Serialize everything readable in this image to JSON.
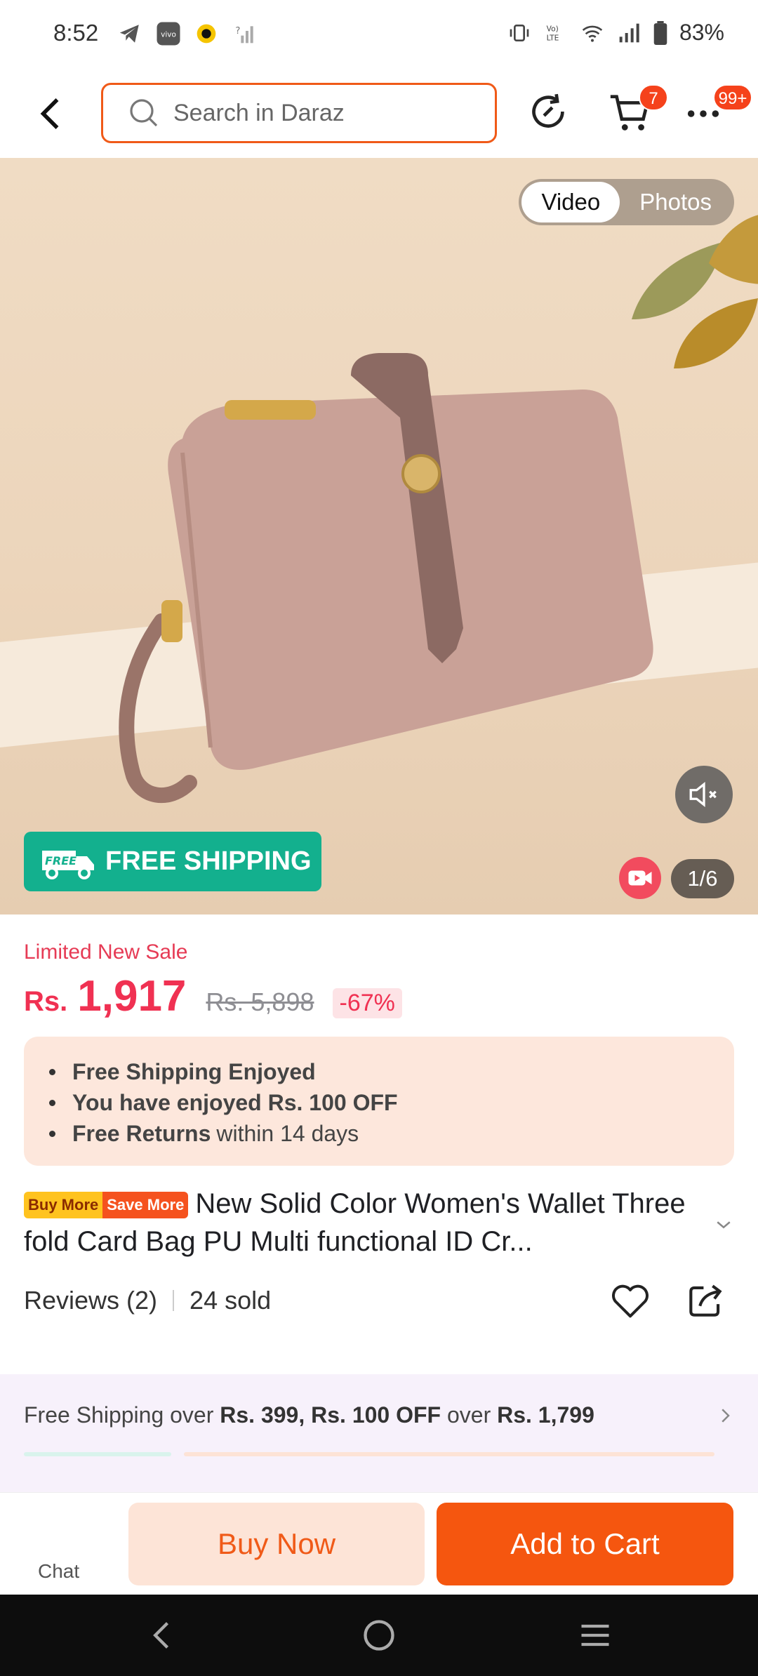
{
  "status_bar": {
    "time": "8:52",
    "battery": "83%"
  },
  "header": {
    "search_placeholder": "Search in Daraz",
    "cart_badge": "7",
    "more_badge": "99+"
  },
  "gallery": {
    "tabs": [
      {
        "label": "Video",
        "active": true
      },
      {
        "label": "Photos",
        "active": false
      }
    ],
    "free_shipping_badge": "FREE SHIPPING",
    "free_icon_text": "FREE",
    "counter": "1/6"
  },
  "price": {
    "sale_label": "Limited New Sale",
    "currency": "Rs.",
    "current": "1,917",
    "original": "Rs. 5,898",
    "discount": "-67%"
  },
  "benefits": [
    {
      "bold": "Free Shipping Enjoyed",
      "rest": ""
    },
    {
      "bold": "You have enjoyed Rs. 100 OFF",
      "rest": ""
    },
    {
      "bold": "Free Returns",
      "rest": "within 14 days"
    }
  ],
  "product": {
    "promo_tag_1": "Buy More",
    "promo_tag_2": "Save More",
    "title": "New Solid Color Women's Wallet Three fold Card Bag PU Multi functional ID Cr..."
  },
  "stats": {
    "reviews": "Reviews (2)",
    "sold": "24 sold"
  },
  "shipping_banner": {
    "prefix": "Free Shipping over ",
    "threshold_1": "Rs. 399, Rs. 100 OFF",
    "middle": " over ",
    "threshold_2": "Rs. 1,799"
  },
  "actions": {
    "chat_label": "Chat",
    "buy_now": "Buy Now",
    "add_to_cart": "Add to Cart"
  },
  "colors": {
    "accent": "#f5560f",
    "price": "#f03152",
    "free_shipping": "#13b08e"
  }
}
